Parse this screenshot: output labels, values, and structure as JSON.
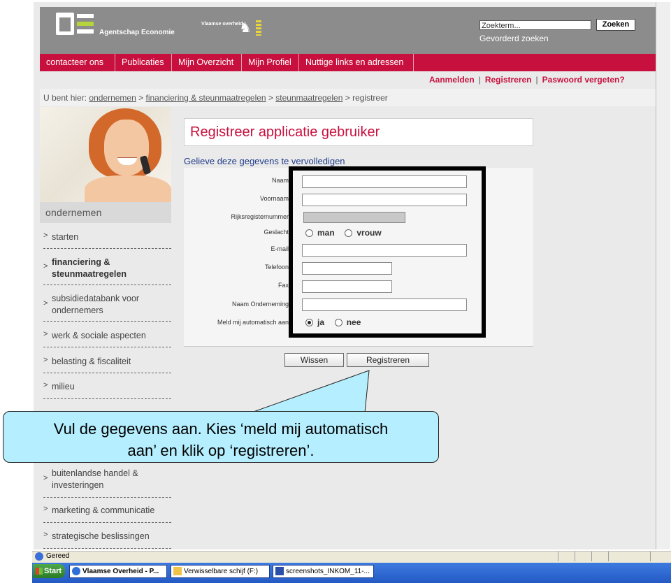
{
  "header": {
    "logo_text": "Agentschap Economie",
    "partner_text": "Vlaamse overheid",
    "search_placeholder": "Zoekterm...",
    "search_button": "Zoeken",
    "advanced_search": "Gevorderd zoeken"
  },
  "nav": [
    "contacteer ons",
    "Publicaties",
    "Mijn Overzicht",
    "Mijn Profiel",
    "Nuttige links en adressen"
  ],
  "account": {
    "login": "Aanmelden",
    "register": "Registreren",
    "forgot": "Paswoord vergeten?"
  },
  "breadcrumb": {
    "prefix": "U bent hier:",
    "items": [
      "ondernemen",
      "financiering & steunmaatregelen",
      "steunmaatregelen"
    ],
    "current": "registreer",
    "separator": ">"
  },
  "sidebar": {
    "heading": "ondernemen",
    "items": [
      {
        "label": "starten"
      },
      {
        "label": "financiering & steunmaatregelen"
      },
      {
        "label": "subsidiedatabank voor ondernemers"
      },
      {
        "label": "werk & sociale aspecten"
      },
      {
        "label": "belasting & fiscaliteit"
      },
      {
        "label": "milieu"
      },
      {
        "label": "buitenlandse handel & investeringen"
      },
      {
        "label": "marketing & communicatie"
      },
      {
        "label": "strategische beslissingen"
      }
    ]
  },
  "form": {
    "title": "Registreer applicatie gebruiker",
    "subtitle": "Gelieve deze gegevens te vervolledigen",
    "labels": {
      "naam": "Naam",
      "voornaam": "Voornaam",
      "rijks": "Rijksregisternummer",
      "geslacht": "Geslacht",
      "email": "E-mail",
      "telefoon": "Telefoon",
      "fax": "Fax",
      "onderneming": "Naam Onderneming",
      "meld": "Meld mij automatisch aan"
    },
    "gender_options": [
      "man",
      "vrouw"
    ],
    "auto_options": [
      "ja",
      "nee"
    ],
    "auto_selected": "ja",
    "clear_button": "Wissen",
    "submit_button": "Registreren"
  },
  "callout": {
    "line1": "Vul de gegevens aan. Kies ‘meld mij automatisch",
    "line2": "aan’ en klik op ‘registreren’."
  },
  "status": {
    "text": "Gereed"
  },
  "taskbar": {
    "start": "Start",
    "tasks": [
      "Vlaamse Overheid - P...",
      "Verwisselbare schijf (F:)",
      "screenshots_INKOM_11-..."
    ]
  },
  "colors": {
    "brand_red": "#c8103e",
    "header_grey": "#8c8c8c",
    "callout_bg": "#b5eefe",
    "subtitle_blue": "#1e3c8a"
  }
}
